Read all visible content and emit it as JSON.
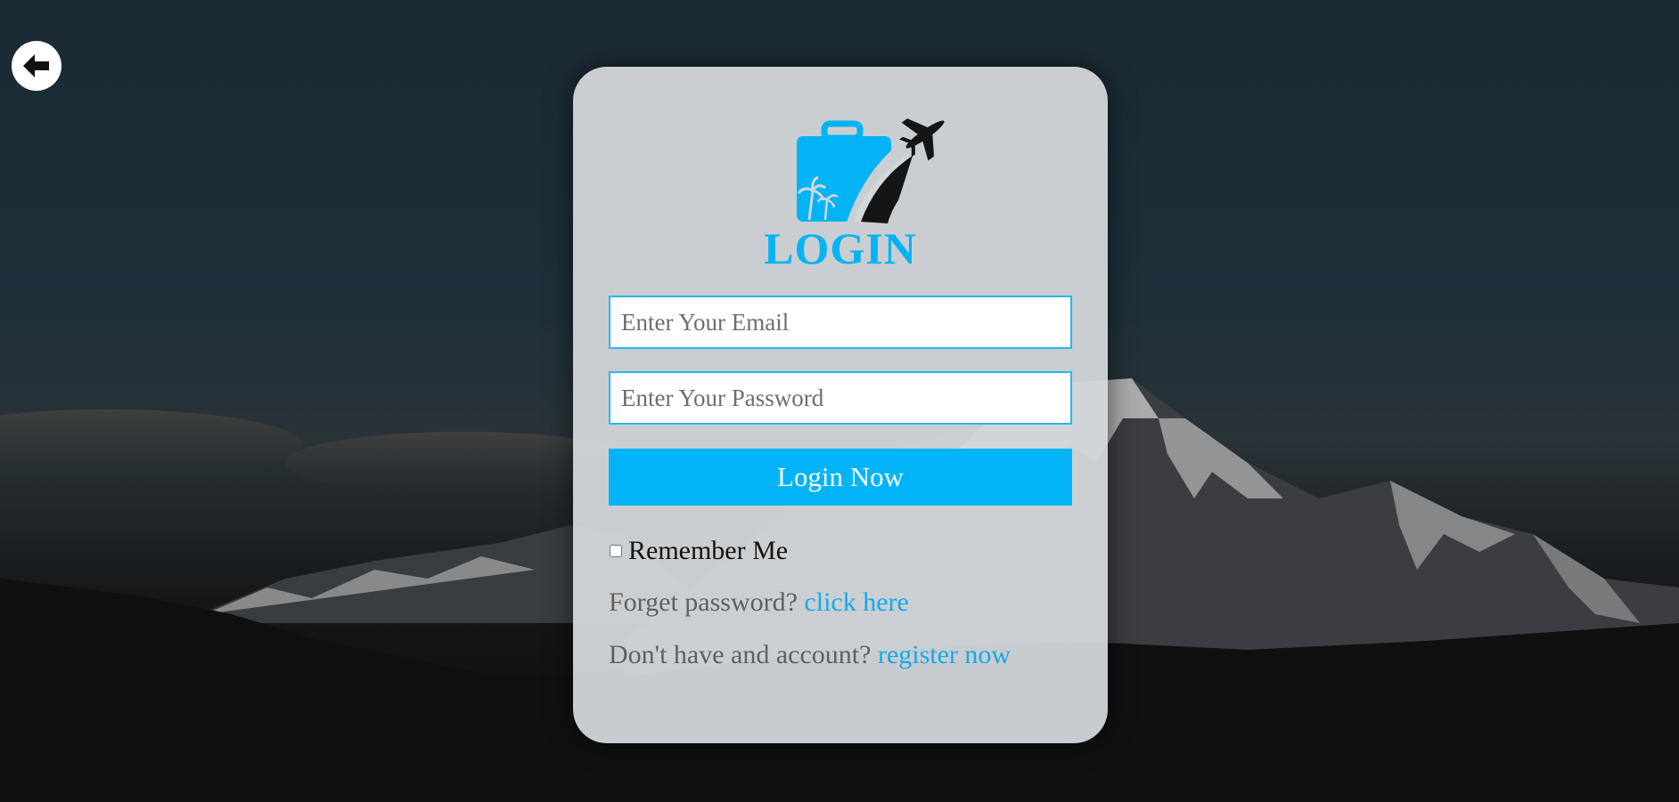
{
  "back": {
    "icon": "arrow-left-icon"
  },
  "logo": {
    "icon": "suitcase-airplane-logo"
  },
  "login": {
    "title": "LOGIN",
    "email_placeholder": "Enter Your Email",
    "password_placeholder": "Enter Your Password",
    "submit_label": "Login Now",
    "remember_label": "Remember Me",
    "forgot_text": "Forget password?",
    "forgot_link": "click here",
    "register_text": "Don't have and account?",
    "register_link": "register now"
  },
  "colors": {
    "accent": "#03b3f5",
    "card": "#d4d7d9",
    "logo_dark": "#151515"
  }
}
